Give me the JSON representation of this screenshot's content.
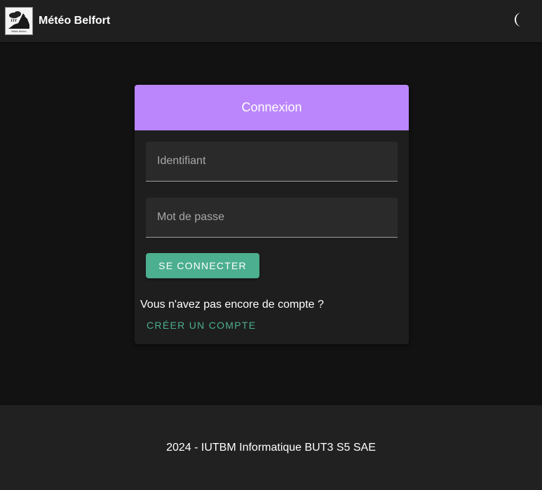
{
  "header": {
    "app_title": "Météo Belfort",
    "logo_caption": "Météo Belfort",
    "theme_toggle_icon": "moon-icon"
  },
  "login": {
    "title": "Connexion",
    "username_placeholder": "Identifiant",
    "password_placeholder": "Mot de passe",
    "submit_label": "SE CONNECTER",
    "no_account_text": "Vous n'avez pas encore de compte ?",
    "create_account_label": "CRÉER UN COMPTE"
  },
  "footer": {
    "text": "2024 - IUTBM Informatique BUT3 S5 SAE"
  },
  "colors": {
    "background": "#121212",
    "surface": "#1e1e1e",
    "header": "#1f1f1f",
    "accent_purple": "#bb86fc",
    "accent_green": "#4caf8f"
  }
}
